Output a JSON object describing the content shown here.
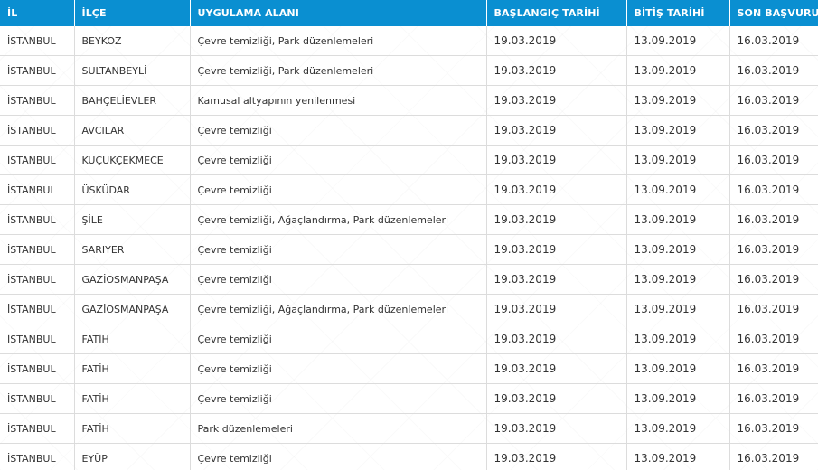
{
  "table": {
    "headers": [
      "İL",
      "İLÇE",
      "UYGULAMA ALANI",
      "BAŞLANGIÇ TARİHİ",
      "BİTİŞ TARİHİ",
      "SON BAŞVURU"
    ],
    "rows": [
      [
        "İSTANBUL",
        "BEYKOZ",
        "Çevre temizliği, Park düzenlemeleri",
        "19.03.2019",
        "13.09.2019",
        "16.03.2019"
      ],
      [
        "İSTANBUL",
        "SULTANBEYLİ",
        "Çevre temizliği, Park düzenlemeleri",
        "19.03.2019",
        "13.09.2019",
        "16.03.2019"
      ],
      [
        "İSTANBUL",
        "BAHÇELİEVLER",
        "Kamusal altyapının yenilenmesi",
        "19.03.2019",
        "13.09.2019",
        "16.03.2019"
      ],
      [
        "İSTANBUL",
        "AVCILAR",
        "Çevre temizliği",
        "19.03.2019",
        "13.09.2019",
        "16.03.2019"
      ],
      [
        "İSTANBUL",
        "KÜÇÜKÇEKMECE",
        "Çevre temizliği",
        "19.03.2019",
        "13.09.2019",
        "16.03.2019"
      ],
      [
        "İSTANBUL",
        "ÜSKÜDAR",
        "Çevre temizliği",
        "19.03.2019",
        "13.09.2019",
        "16.03.2019"
      ],
      [
        "İSTANBUL",
        "ŞİLE",
        "Çevre temizliği, Ağaçlandırma, Park düzenlemeleri",
        "19.03.2019",
        "13.09.2019",
        "16.03.2019"
      ],
      [
        "İSTANBUL",
        "SARIYER",
        "Çevre temizliği",
        "19.03.2019",
        "13.09.2019",
        "16.03.2019"
      ],
      [
        "İSTANBUL",
        "GAZİOSMANPAŞA",
        "Çevre temizliği",
        "19.03.2019",
        "13.09.2019",
        "16.03.2019"
      ],
      [
        "İSTANBUL",
        "GAZİOSMANPAŞA",
        "Çevre temizliği, Ağaçlandırma, Park düzenlemeleri",
        "19.03.2019",
        "13.09.2019",
        "16.03.2019"
      ],
      [
        "İSTANBUL",
        "FATİH",
        "Çevre temizliği",
        "19.03.2019",
        "13.09.2019",
        "16.03.2019"
      ],
      [
        "İSTANBUL",
        "FATİH",
        "Çevre temizliği",
        "19.03.2019",
        "13.09.2019",
        "16.03.2019"
      ],
      [
        "İSTANBUL",
        "FATİH",
        "Çevre temizliği",
        "19.03.2019",
        "13.09.2019",
        "16.03.2019"
      ],
      [
        "İSTANBUL",
        "FATİH",
        "Park düzenlemeleri",
        "19.03.2019",
        "13.09.2019",
        "16.03.2019"
      ],
      [
        "İSTANBUL",
        "EYÜP",
        "Çevre temizliği",
        "19.03.2019",
        "13.09.2019",
        "16.03.2019"
      ]
    ]
  },
  "colors": {
    "header_bg": "#0a8fd1",
    "header_text": "#ffffff",
    "border": "#dcdcdc"
  }
}
